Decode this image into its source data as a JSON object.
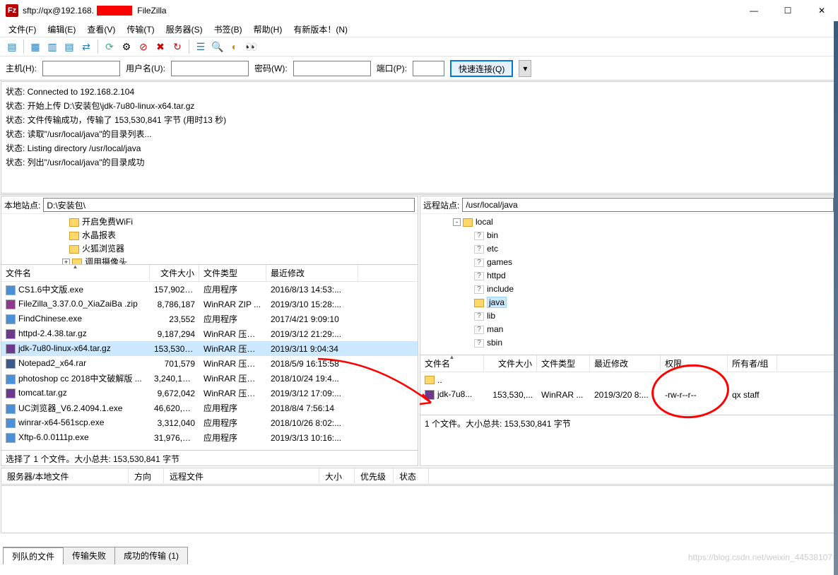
{
  "title_prefix": "sftp://qx@192.168.",
  "title_suffix": " FileZilla",
  "menu": [
    "文件(F)",
    "编辑(E)",
    "查看(V)",
    "传输(T)",
    "服务器(S)",
    "书签(B)",
    "帮助(H)",
    "有新版本！(N)"
  ],
  "quick": {
    "host_lbl": "主机(H):",
    "user_lbl": "用户名(U):",
    "pass_lbl": "密码(W):",
    "port_lbl": "端口(P):",
    "btn": "快速连接(Q)"
  },
  "log": [
    "状态: Connected to 192.168.2.104",
    "状态: 开始上传 D:\\安装包\\jdk-7u80-linux-x64.tar.gz",
    "状态: 文件传输成功，传输了 153,530,841 字节 (用时13 秒)",
    "状态: 读取\"/usr/local/java\"的目录列表...",
    "状态: Listing directory /usr/local/java",
    "状态: 列出\"/usr/local/java\"的目录成功"
  ],
  "local": {
    "site_lbl": "本地站点:",
    "path": "D:\\安装包\\",
    "tree": [
      {
        "indent": 90,
        "icon": "fold",
        "label": "开启免费WiFi"
      },
      {
        "indent": 90,
        "icon": "fold",
        "label": "水晶报表"
      },
      {
        "indent": 90,
        "icon": "fold",
        "label": "火狐浏览器"
      },
      {
        "indent": 80,
        "exp": "+",
        "icon": "fold",
        "label": "调用摄像头"
      }
    ],
    "cols": [
      "文件名",
      "文件大小",
      "文件类型",
      "最近修改"
    ],
    "rows": [
      {
        "icon": "exe",
        "name": "CS1.6中文版.exe",
        "size": "157,902,1...",
        "type": "应用程序",
        "date": "2016/8/13 14:53:..."
      },
      {
        "icon": "zip",
        "name": "FileZilla_3.37.0.0_XiaZaiBa .zip",
        "size": "8,786,187",
        "type": "WinRAR ZIP ...",
        "date": "2019/3/10 15:28:..."
      },
      {
        "icon": "exe",
        "name": "FindChinese.exe",
        "size": "23,552",
        "type": "应用程序",
        "date": "2017/4/21 9:09:10"
      },
      {
        "icon": "gz",
        "name": "httpd-2.4.38.tar.gz",
        "size": "9,187,294",
        "type": "WinRAR 压缩...",
        "date": "2019/3/12 21:29:..."
      },
      {
        "icon": "gz",
        "name": "jdk-7u80-linux-x64.tar.gz",
        "size": "153,530,8...",
        "type": "WinRAR 压缩...",
        "date": "2019/3/11 9:04:34",
        "sel": true
      },
      {
        "icon": "rar",
        "name": "Notepad2_x64.rar",
        "size": "701,579",
        "type": "WinRAR 压缩...",
        "date": "2018/5/9 16:15:58"
      },
      {
        "icon": "exe",
        "name": "photoshop cc 2018中文破解版 ...",
        "size": "3,240,133,...",
        "type": "WinRAR 压缩...",
        "date": "2018/10/24 19:4..."
      },
      {
        "icon": "gz",
        "name": "tomcat.tar.gz",
        "size": "9,672,042",
        "type": "WinRAR 压缩...",
        "date": "2019/3/12 17:09:..."
      },
      {
        "icon": "exe",
        "name": "UC浏览器_V6.2.4094.1.exe",
        "size": "46,620,904",
        "type": "应用程序",
        "date": "2018/8/4 7:56:14"
      },
      {
        "icon": "exe",
        "name": "winrar-x64-561scp.exe",
        "size": "3,312,040",
        "type": "应用程序",
        "date": "2018/10/26 8:02:..."
      },
      {
        "icon": "exe",
        "name": "Xftp-6.0.0111p.exe",
        "size": "31,976,272",
        "type": "应用程序",
        "date": "2019/3/13 10:16:..."
      }
    ],
    "status": "选择了 1 个文件。大小总共: 153,530,841 字节"
  },
  "remote": {
    "site_lbl": "远程站点:",
    "path": "/usr/local/java",
    "tree": [
      {
        "indent": 40,
        "exp": "-",
        "icon": "fold",
        "label": "local"
      },
      {
        "indent": 70,
        "icon": "qfold",
        "label": "bin"
      },
      {
        "indent": 70,
        "icon": "qfold",
        "label": "etc"
      },
      {
        "indent": 70,
        "icon": "qfold",
        "label": "games"
      },
      {
        "indent": 70,
        "icon": "qfold",
        "label": "httpd"
      },
      {
        "indent": 70,
        "icon": "qfold",
        "label": "include"
      },
      {
        "indent": 70,
        "icon": "fold",
        "label": "java",
        "sel": true
      },
      {
        "indent": 70,
        "icon": "qfold",
        "label": "lib"
      },
      {
        "indent": 70,
        "icon": "qfold",
        "label": "man"
      },
      {
        "indent": 70,
        "icon": "qfold",
        "label": "sbin"
      }
    ],
    "cols": [
      "文件名",
      "文件大小",
      "文件类型",
      "最近修改",
      "权限",
      "所有者/组"
    ],
    "rows": [
      {
        "up": true,
        "name": ".."
      },
      {
        "icon": "gz",
        "name": "jdk-7u8...",
        "size": "153,530,...",
        "type": "WinRAR ...",
        "date": "2019/3/20 8:...",
        "perm": "-rw-r--r--",
        "owner": "qx staff"
      }
    ],
    "status": "1 个文件。大小总共: 153,530,841 字节"
  },
  "queue_cols": [
    "服务器/本地文件",
    "方向",
    "远程文件",
    "大小",
    "优先级",
    "状态"
  ],
  "tabs": [
    "列队的文件",
    "传输失败",
    "成功的传输  (1)"
  ],
  "watermark": "https://blog.csdn.net/weixin_44538107"
}
